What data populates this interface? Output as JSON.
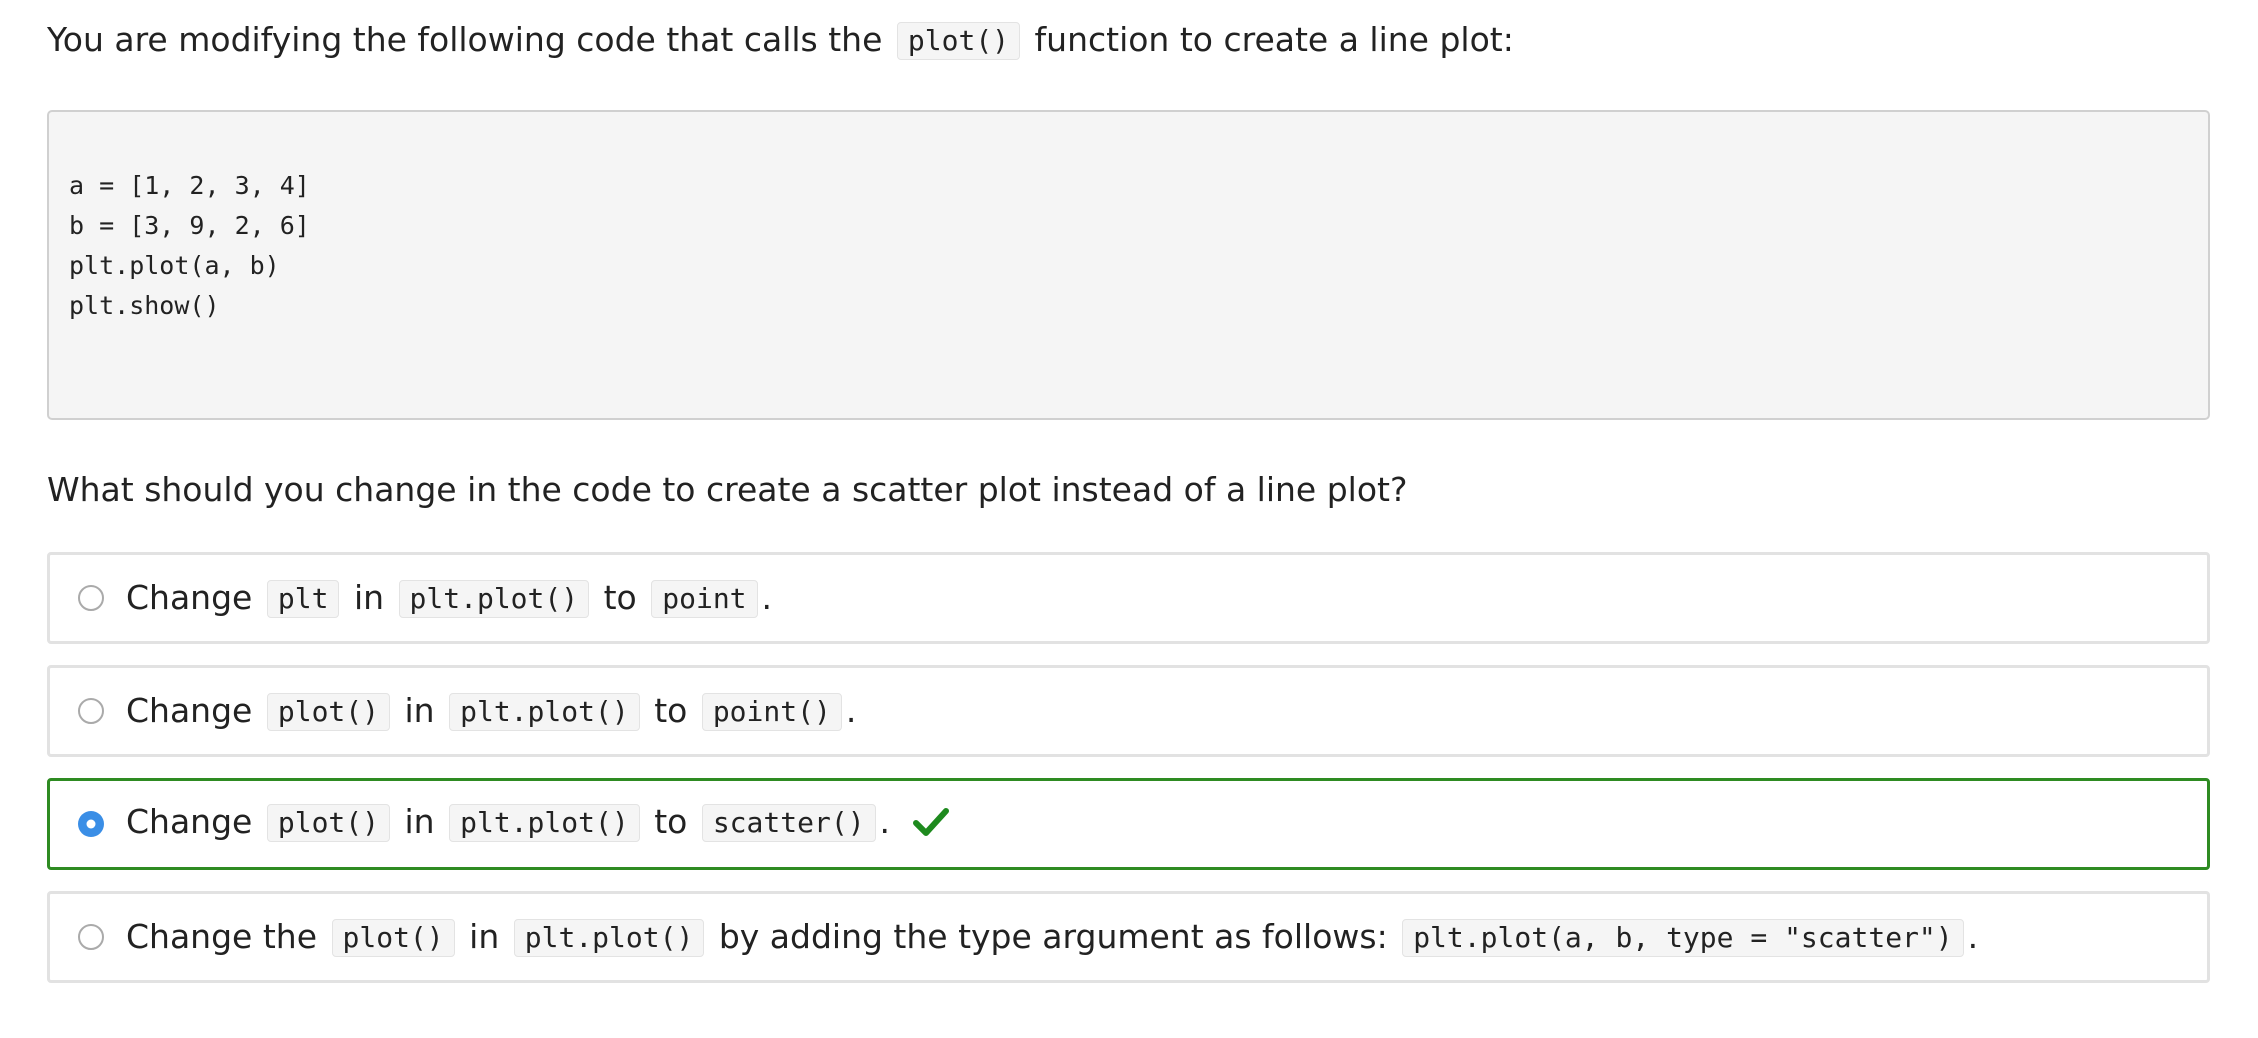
{
  "intro": {
    "before": "You are modifying the following code that calls the",
    "code": "plot()",
    "after": "function to create a line plot:"
  },
  "code_block": {
    "lines": [
      "a = [1, 2, 3, 4]",
      "b = [3, 9, 2, 6]",
      "plt.plot(a, b)",
      "plt.show()"
    ]
  },
  "question": "What should you change in the code to create a scatter plot instead of a line plot?",
  "options": [
    {
      "selected": false,
      "correct": false,
      "parts": [
        "Change",
        "plt",
        "in",
        "plt.plot()",
        "to",
        "point",
        "."
      ]
    },
    {
      "selected": false,
      "correct": false,
      "parts": [
        "Change",
        "plot()",
        "in",
        "plt.plot()",
        "to",
        "point()",
        "."
      ]
    },
    {
      "selected": true,
      "correct": true,
      "parts": [
        "Change",
        "plot()",
        "in",
        "plt.plot()",
        "to",
        "scatter()",
        "."
      ]
    },
    {
      "selected": false,
      "correct": false,
      "parts": [
        "Change the",
        "plot()",
        "in",
        "plt.plot()",
        "by adding the type argument as follows:",
        "plt.plot(a, b, type = \"scatter\")",
        "."
      ]
    }
  ],
  "colors": {
    "correct_border": "#2e8b22",
    "check_mark": "#1e8a1e",
    "radio_selected": "#3a8ee6"
  },
  "icons": {
    "correct": "check-icon"
  }
}
